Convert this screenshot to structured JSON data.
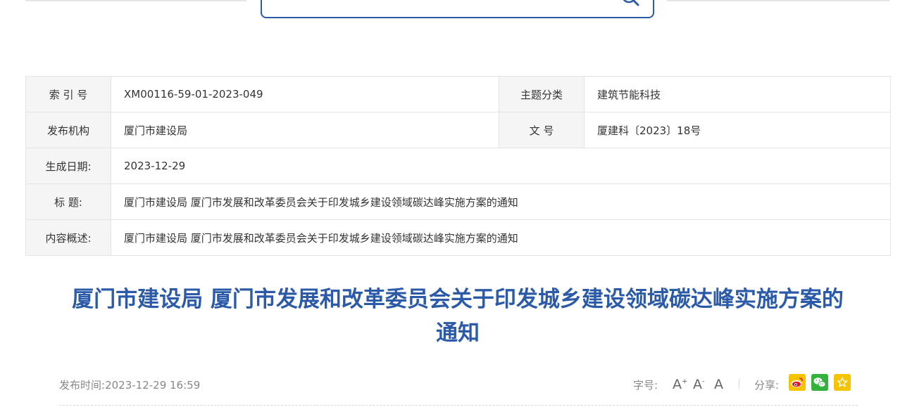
{
  "info": {
    "rows": [
      {
        "label": "索 引 号",
        "value": "XM00116-59-01-2023-049",
        "label2": "主题分类",
        "value2": "建筑节能科技"
      },
      {
        "label": "发布机构",
        "value": "厦门市建设局",
        "label2": "文 号",
        "value2": "厦建科〔2023〕18号"
      },
      {
        "label": "生成日期:",
        "value": "2023-12-29"
      },
      {
        "label": "标 题:",
        "value": "厦门市建设局 厦门市发展和改革委员会关于印发城乡建设领域碳达峰实施方案的通知"
      },
      {
        "label": "内容概述:",
        "value": "厦门市建设局 厦门市发展和改革委员会关于印发城乡建设领域碳达峰实施方案的通知"
      }
    ]
  },
  "article": {
    "title_line1": "厦门市建设局 厦门市发展和改革委员会关于印发城乡建设领域碳达峰实施方案的",
    "title_line2": "通知"
  },
  "meta": {
    "pub_label": "发布时间:",
    "pub_time": "2023-12-29 16:59",
    "font_label": "字号:",
    "font_large": "A",
    "font_large_sup": "+",
    "font_medium": "A",
    "font_medium_sup": "-",
    "font_small": "A",
    "share_label": "分享:"
  },
  "icons": {
    "search": "search-icon",
    "weibo": "weibo-icon",
    "wechat": "wechat-icon",
    "favorite": "star-icon"
  },
  "colors": {
    "accent": "#2b5aa9",
    "weibo": "#f5c400",
    "wechat": "#33b33b"
  }
}
